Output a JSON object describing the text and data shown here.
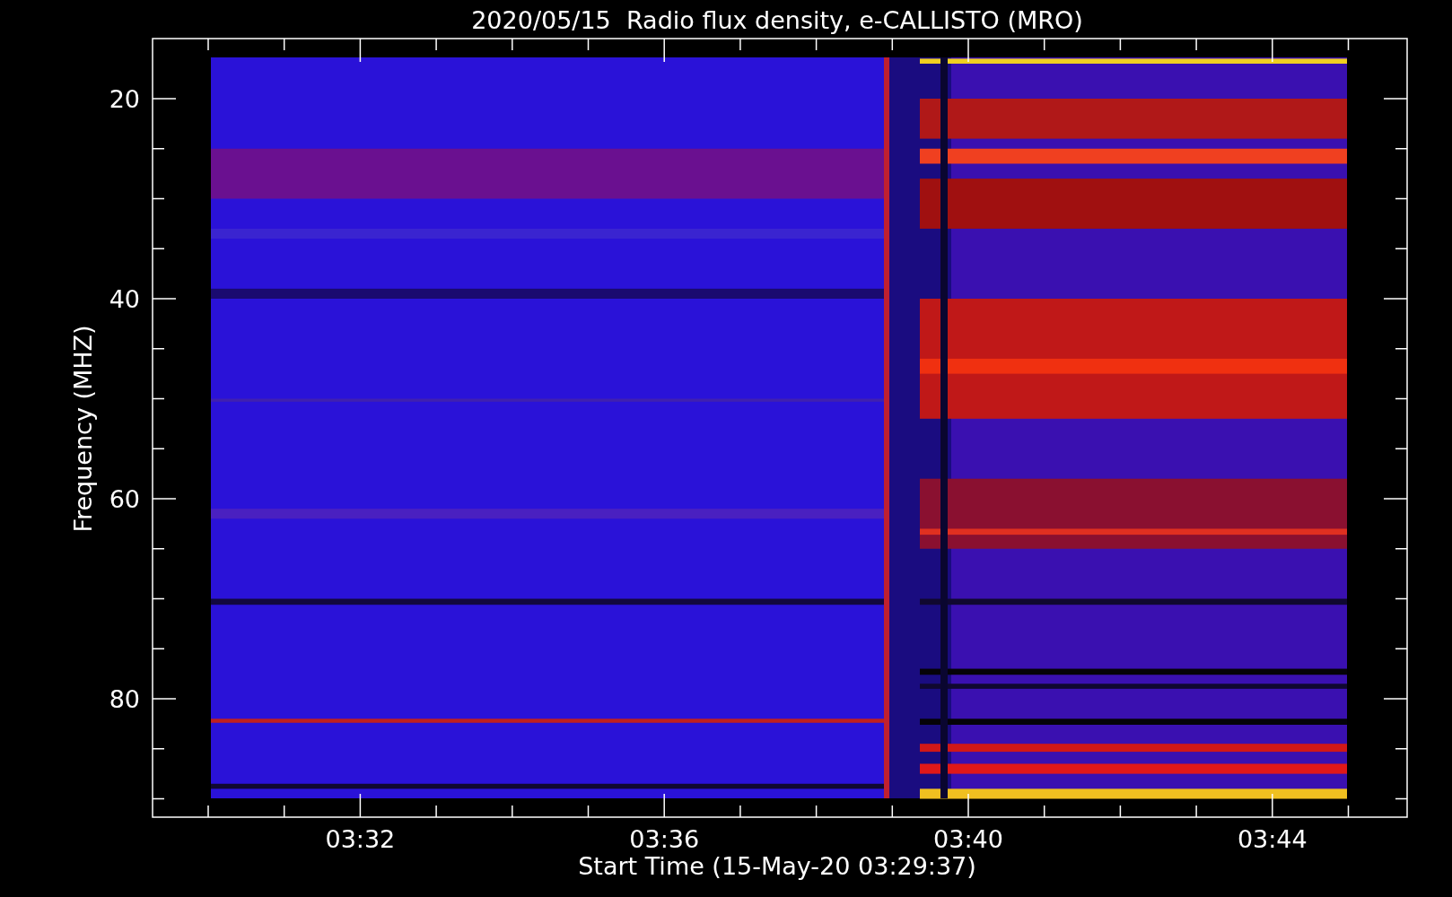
{
  "title": "2020/05/15  Radio flux density, e-CALLISTO (MRO)",
  "y_axis": {
    "label": "Frequency (MHZ)",
    "ticks": [
      "20",
      "40",
      "60",
      "80"
    ]
  },
  "x_axis": {
    "label": "Start Time (15-May-20 03:29:37)",
    "ticks": [
      "03:32",
      "03:36",
      "03:40",
      "03:44"
    ]
  }
}
